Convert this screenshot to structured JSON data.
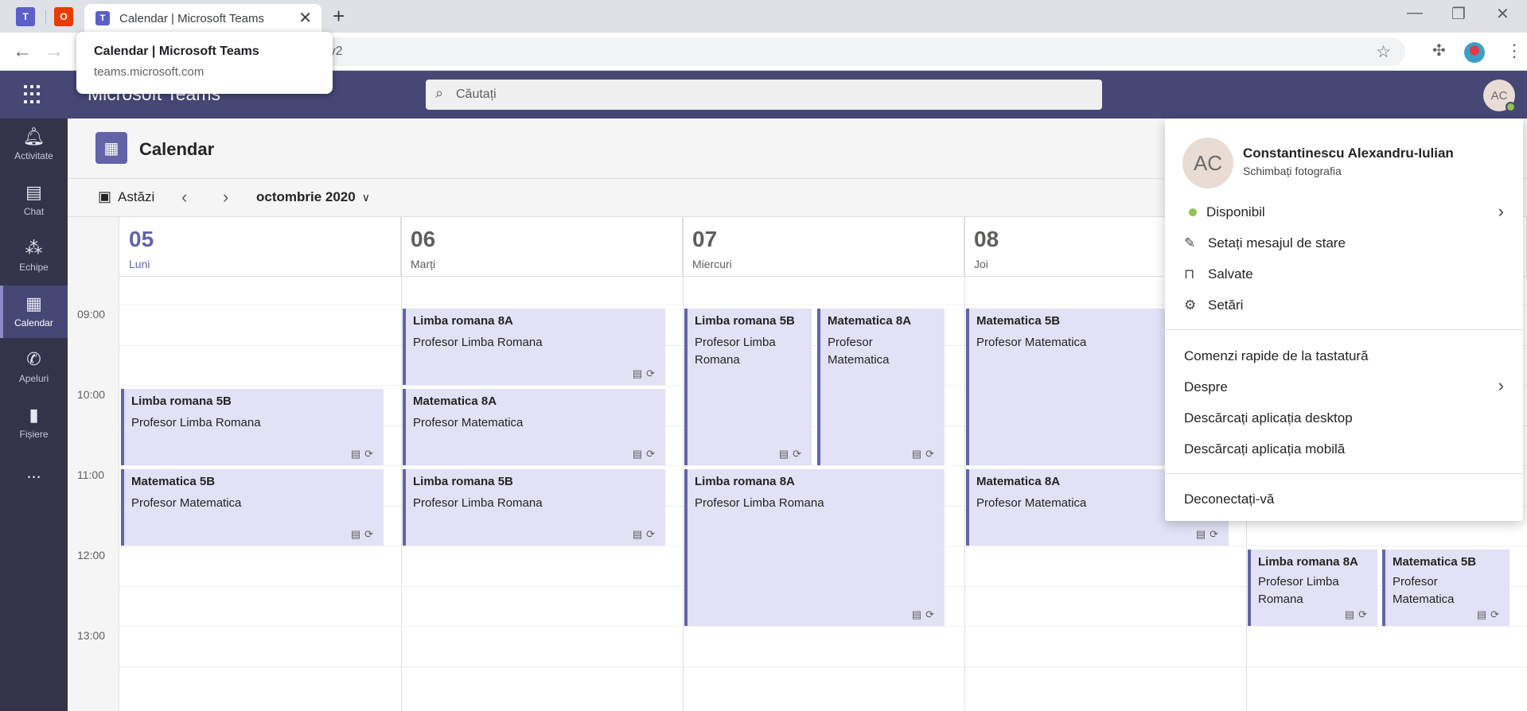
{
  "browser": {
    "pinned_tab_1": "T",
    "pinned_tab_2": "O",
    "tab_title": "Calendar | Microsoft Teams",
    "url_partial": "larv2",
    "tooltip_title": "Calendar | Microsoft Teams",
    "tooltip_domain": "teams.microsoft.com"
  },
  "teams": {
    "app_name": "Microsoft Teams",
    "search_placeholder": "Căutați",
    "user_initials": "AC"
  },
  "rail": {
    "items": [
      {
        "label": "Activitate",
        "icon": "bell-icon"
      },
      {
        "label": "Chat",
        "icon": "chat-icon"
      },
      {
        "label": "Echipe",
        "icon": "teams-icon"
      },
      {
        "label": "Calendar",
        "icon": "calendar-icon"
      },
      {
        "label": "Apeluri",
        "icon": "phone-icon"
      },
      {
        "label": "Fișiere",
        "icon": "file-icon"
      }
    ],
    "more": "..."
  },
  "calendar": {
    "title": "Calendar",
    "today_label": "Astăzi",
    "month_label": "octombrie 2020",
    "days": [
      {
        "num": "05",
        "name": "Luni"
      },
      {
        "num": "06",
        "name": "Marți"
      },
      {
        "num": "07",
        "name": "Miercuri"
      },
      {
        "num": "08",
        "name": "Joi"
      },
      {
        "num": "",
        "name": ""
      }
    ],
    "times": [
      "09:00",
      "10:00",
      "11:00",
      "12:00",
      "13:00"
    ],
    "events": [
      {
        "title": "Limba romana 5B",
        "organizer": "Profesor Limba Romana"
      },
      {
        "title": "Matematica 5B",
        "organizer": "Profesor Matematica"
      },
      {
        "title": "Limba romana 8A",
        "organizer": "Profesor Limba Romana"
      },
      {
        "title": "Matematica 8A",
        "organizer": "Profesor Matematica"
      },
      {
        "title": "Limba romana 5B",
        "organizer": "Profesor Limba Romana"
      },
      {
        "title": "Limba romana 5B",
        "organizer": "Profesor Limba Romana"
      },
      {
        "title": "Matematica 8A",
        "organizer": "Profesor Matematica"
      },
      {
        "title": "Limba romana 8A",
        "organizer": "Profesor Limba Romana"
      },
      {
        "title": "Matematica 5B",
        "organizer": "Profesor Matematica"
      },
      {
        "title": "Matematica 8A",
        "organizer": "Profesor Matematica"
      },
      {
        "title": "Limba romana 8A",
        "organizer": "Profesor Limba Romana"
      },
      {
        "title": "Matematica 5B",
        "organizer": "Profesor Matematica"
      }
    ]
  },
  "profile_menu": {
    "full_name": "Constantinescu Alexandru-Iulian",
    "change_photo": "Schimbați fotografia",
    "status": "Disponibil",
    "set_status_message": "Setați mesajul de stare",
    "saved": "Salvate",
    "settings": "Setări",
    "keyboard_shortcuts": "Comenzi rapide de la tastatură",
    "about": "Despre",
    "download_desktop": "Descărcați aplicația desktop",
    "download_mobile": "Descărcați aplicația mobilă",
    "sign_out": "Deconectați-vă"
  }
}
